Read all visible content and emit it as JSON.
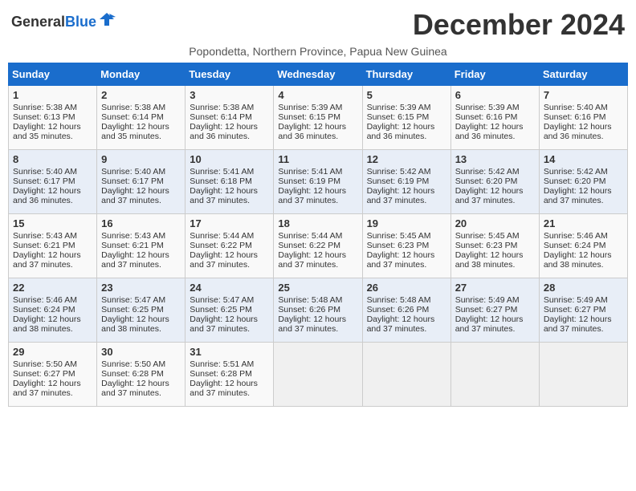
{
  "header": {
    "logo_general": "General",
    "logo_blue": "Blue",
    "month_title": "December 2024",
    "subtitle": "Popondetta, Northern Province, Papua New Guinea"
  },
  "days_of_week": [
    "Sunday",
    "Monday",
    "Tuesday",
    "Wednesday",
    "Thursday",
    "Friday",
    "Saturday"
  ],
  "weeks": [
    [
      {
        "day": "1",
        "sunrise": "Sunrise: 5:38 AM",
        "sunset": "Sunset: 6:13 PM",
        "daylight": "Daylight: 12 hours and 35 minutes."
      },
      {
        "day": "2",
        "sunrise": "Sunrise: 5:38 AM",
        "sunset": "Sunset: 6:14 PM",
        "daylight": "Daylight: 12 hours and 35 minutes."
      },
      {
        "day": "3",
        "sunrise": "Sunrise: 5:38 AM",
        "sunset": "Sunset: 6:14 PM",
        "daylight": "Daylight: 12 hours and 36 minutes."
      },
      {
        "day": "4",
        "sunrise": "Sunrise: 5:39 AM",
        "sunset": "Sunset: 6:15 PM",
        "daylight": "Daylight: 12 hours and 36 minutes."
      },
      {
        "day": "5",
        "sunrise": "Sunrise: 5:39 AM",
        "sunset": "Sunset: 6:15 PM",
        "daylight": "Daylight: 12 hours and 36 minutes."
      },
      {
        "day": "6",
        "sunrise": "Sunrise: 5:39 AM",
        "sunset": "Sunset: 6:16 PM",
        "daylight": "Daylight: 12 hours and 36 minutes."
      },
      {
        "day": "7",
        "sunrise": "Sunrise: 5:40 AM",
        "sunset": "Sunset: 6:16 PM",
        "daylight": "Daylight: 12 hours and 36 minutes."
      }
    ],
    [
      {
        "day": "8",
        "sunrise": "Sunrise: 5:40 AM",
        "sunset": "Sunset: 6:17 PM",
        "daylight": "Daylight: 12 hours and 36 minutes."
      },
      {
        "day": "9",
        "sunrise": "Sunrise: 5:40 AM",
        "sunset": "Sunset: 6:17 PM",
        "daylight": "Daylight: 12 hours and 37 minutes."
      },
      {
        "day": "10",
        "sunrise": "Sunrise: 5:41 AM",
        "sunset": "Sunset: 6:18 PM",
        "daylight": "Daylight: 12 hours and 37 minutes."
      },
      {
        "day": "11",
        "sunrise": "Sunrise: 5:41 AM",
        "sunset": "Sunset: 6:19 PM",
        "daylight": "Daylight: 12 hours and 37 minutes."
      },
      {
        "day": "12",
        "sunrise": "Sunrise: 5:42 AM",
        "sunset": "Sunset: 6:19 PM",
        "daylight": "Daylight: 12 hours and 37 minutes."
      },
      {
        "day": "13",
        "sunrise": "Sunrise: 5:42 AM",
        "sunset": "Sunset: 6:20 PM",
        "daylight": "Daylight: 12 hours and 37 minutes."
      },
      {
        "day": "14",
        "sunrise": "Sunrise: 5:42 AM",
        "sunset": "Sunset: 6:20 PM",
        "daylight": "Daylight: 12 hours and 37 minutes."
      }
    ],
    [
      {
        "day": "15",
        "sunrise": "Sunrise: 5:43 AM",
        "sunset": "Sunset: 6:21 PM",
        "daylight": "Daylight: 12 hours and 37 minutes."
      },
      {
        "day": "16",
        "sunrise": "Sunrise: 5:43 AM",
        "sunset": "Sunset: 6:21 PM",
        "daylight": "Daylight: 12 hours and 37 minutes."
      },
      {
        "day": "17",
        "sunrise": "Sunrise: 5:44 AM",
        "sunset": "Sunset: 6:22 PM",
        "daylight": "Daylight: 12 hours and 37 minutes."
      },
      {
        "day": "18",
        "sunrise": "Sunrise: 5:44 AM",
        "sunset": "Sunset: 6:22 PM",
        "daylight": "Daylight: 12 hours and 37 minutes."
      },
      {
        "day": "19",
        "sunrise": "Sunrise: 5:45 AM",
        "sunset": "Sunset: 6:23 PM",
        "daylight": "Daylight: 12 hours and 37 minutes."
      },
      {
        "day": "20",
        "sunrise": "Sunrise: 5:45 AM",
        "sunset": "Sunset: 6:23 PM",
        "daylight": "Daylight: 12 hours and 38 minutes."
      },
      {
        "day": "21",
        "sunrise": "Sunrise: 5:46 AM",
        "sunset": "Sunset: 6:24 PM",
        "daylight": "Daylight: 12 hours and 38 minutes."
      }
    ],
    [
      {
        "day": "22",
        "sunrise": "Sunrise: 5:46 AM",
        "sunset": "Sunset: 6:24 PM",
        "daylight": "Daylight: 12 hours and 38 minutes."
      },
      {
        "day": "23",
        "sunrise": "Sunrise: 5:47 AM",
        "sunset": "Sunset: 6:25 PM",
        "daylight": "Daylight: 12 hours and 38 minutes."
      },
      {
        "day": "24",
        "sunrise": "Sunrise: 5:47 AM",
        "sunset": "Sunset: 6:25 PM",
        "daylight": "Daylight: 12 hours and 37 minutes."
      },
      {
        "day": "25",
        "sunrise": "Sunrise: 5:48 AM",
        "sunset": "Sunset: 6:26 PM",
        "daylight": "Daylight: 12 hours and 37 minutes."
      },
      {
        "day": "26",
        "sunrise": "Sunrise: 5:48 AM",
        "sunset": "Sunset: 6:26 PM",
        "daylight": "Daylight: 12 hours and 37 minutes."
      },
      {
        "day": "27",
        "sunrise": "Sunrise: 5:49 AM",
        "sunset": "Sunset: 6:27 PM",
        "daylight": "Daylight: 12 hours and 37 minutes."
      },
      {
        "day": "28",
        "sunrise": "Sunrise: 5:49 AM",
        "sunset": "Sunset: 6:27 PM",
        "daylight": "Daylight: 12 hours and 37 minutes."
      }
    ],
    [
      {
        "day": "29",
        "sunrise": "Sunrise: 5:50 AM",
        "sunset": "Sunset: 6:27 PM",
        "daylight": "Daylight: 12 hours and 37 minutes."
      },
      {
        "day": "30",
        "sunrise": "Sunrise: 5:50 AM",
        "sunset": "Sunset: 6:28 PM",
        "daylight": "Daylight: 12 hours and 37 minutes."
      },
      {
        "day": "31",
        "sunrise": "Sunrise: 5:51 AM",
        "sunset": "Sunset: 6:28 PM",
        "daylight": "Daylight: 12 hours and 37 minutes."
      },
      {
        "day": "",
        "sunrise": "",
        "sunset": "",
        "daylight": ""
      },
      {
        "day": "",
        "sunrise": "",
        "sunset": "",
        "daylight": ""
      },
      {
        "day": "",
        "sunrise": "",
        "sunset": "",
        "daylight": ""
      },
      {
        "day": "",
        "sunrise": "",
        "sunset": "",
        "daylight": ""
      }
    ]
  ]
}
